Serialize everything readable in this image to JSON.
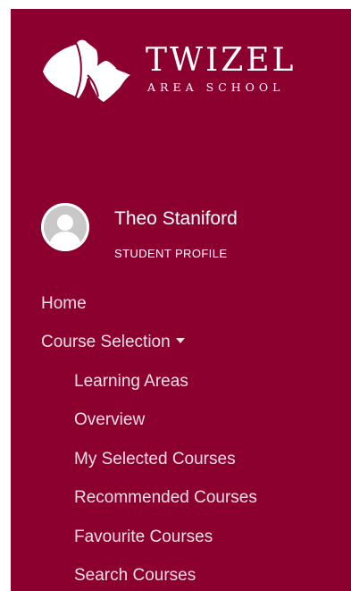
{
  "brand": {
    "name": "TWIZEL",
    "subtitle": "AREA SCHOOL",
    "logo_icon": "mountain-leaf-logo-icon",
    "color": "#8c0030"
  },
  "profile": {
    "name": "Theo Staniford",
    "role": "STUDENT PROFILE",
    "avatar_icon": "default-user-avatar-icon"
  },
  "nav": {
    "home": "Home",
    "course_selection": {
      "label": "Course Selection",
      "icon": "caret-down-icon",
      "items": [
        "Learning Areas",
        "Overview",
        "My Selected Courses",
        "Recommended Courses",
        "Favourite Courses",
        "Search Courses"
      ]
    }
  }
}
